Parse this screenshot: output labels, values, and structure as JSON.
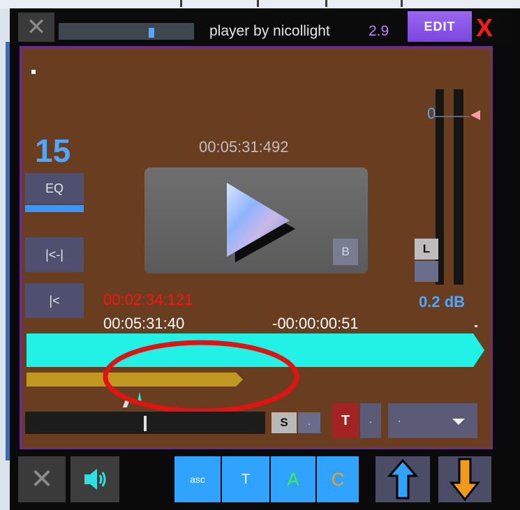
{
  "titlebar": {
    "title": "player by nicollight",
    "version": "2.9",
    "edit_label": "EDIT",
    "close_label": "X",
    "left_x_label": "✕"
  },
  "panel": {
    "count": "15",
    "time_top": "00:05:31:492",
    "eq_label": "EQ",
    "skip_back_label": "|<-|",
    "start_label": "|<",
    "b_label": "B",
    "meter": {
      "zero_label": "0",
      "l_label": "L",
      "db_label": "0.2 dB"
    },
    "time_red": "00:02:34:121",
    "time_elapsed": "00:05:31:40",
    "time_remaining": "-00:00:00:51",
    "s_label": "S",
    "s_dot": ".",
    "t_label": "T",
    "t_dot": ".",
    "dropdown_value": "."
  },
  "bottombar": {
    "x_label": "✕",
    "asc_label": "asc",
    "t_label": "T",
    "a_label": "A",
    "c_label": "C"
  },
  "colors": {
    "panel_bg": "#693d1f",
    "panel_border": "#6a2d8c",
    "accent_blue": "#4fa5ff",
    "cyan_bar": "#22f2e6",
    "gold_bar": "#c0971f",
    "annotation_red": "#e01212",
    "edit_purple": "#8a55e8",
    "button_blue": "#2fa3ff"
  },
  "icons": [
    "close-icon",
    "play-icon",
    "speaker-icon",
    "up-arrow-icon",
    "down-arrow-icon",
    "caret-down-icon",
    "meter-pointer-icon"
  ]
}
